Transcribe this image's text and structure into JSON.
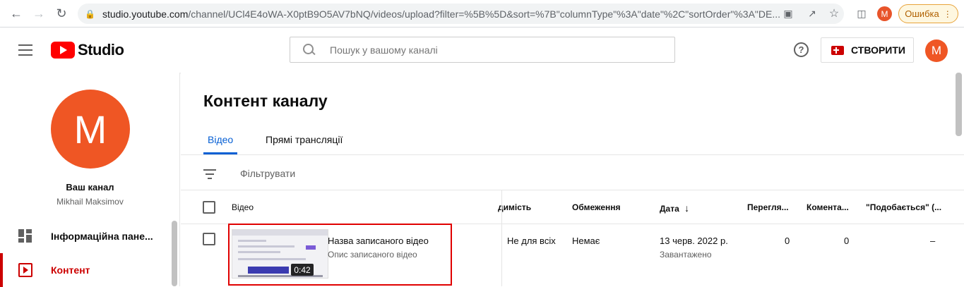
{
  "browser": {
    "url_host": "studio.youtube.com",
    "url_rest": "/channel/UCl4E4oWA-X0ptB9O5AV7bNQ/videos/upload?filter=%5B%5D&sort=%7B\"columnType\"%3A\"date\"%2C\"sortOrder\"%3A\"DE...",
    "profile_letter": "M",
    "error_label": "Ошибка"
  },
  "header": {
    "logo_text": "Studio",
    "search_placeholder": "Пошук у вашому каналі",
    "help_symbol": "?",
    "create_label": "СТВОРИТИ",
    "avatar_letter": "M"
  },
  "sidebar": {
    "avatar_letter": "M",
    "channel_title": "Ваш канал",
    "channel_name": "Mikhail Maksimov",
    "items": [
      {
        "label": "Інформаційна пане..."
      },
      {
        "label": "Контент"
      }
    ]
  },
  "main": {
    "title": "Контент каналу",
    "tabs": [
      {
        "label": "Відео"
      },
      {
        "label": "Прямі трансляції"
      }
    ],
    "filter_label": "Фільтрувати",
    "columns": {
      "video": "Відео",
      "visibility": "димість",
      "restrictions": "Обмеження",
      "date": "Дата",
      "views": "Перегля...",
      "comments": "Комента...",
      "likes": "\"Подобається\" (..."
    },
    "row": {
      "title": "Назва записаного відео",
      "description": "Опис записаного відео",
      "duration": "0:42",
      "visibility": "Не для всіх",
      "restrictions": "Немає",
      "date": "13 черв. 2022 р.",
      "date_status": "Завантажено",
      "views": "0",
      "comments": "0",
      "likes": "–"
    }
  }
}
